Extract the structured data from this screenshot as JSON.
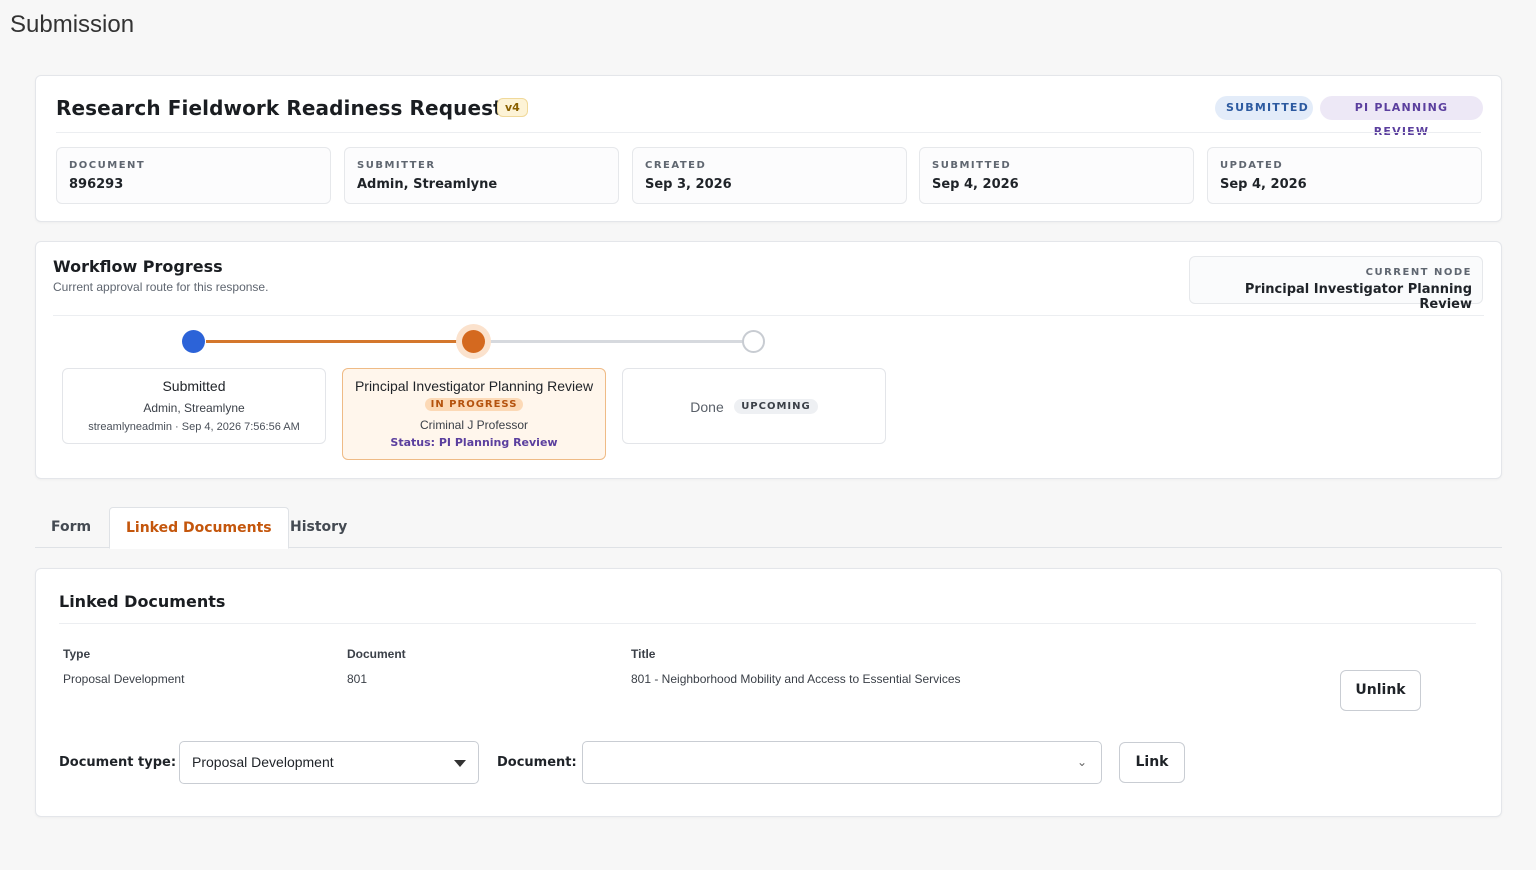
{
  "page": {
    "title": "Submission"
  },
  "header": {
    "title": "Research Fieldwork Readiness Request",
    "version": "v4",
    "status_pills": [
      "SUBMITTED",
      "PI PLANNING REVIEW"
    ],
    "meta": [
      {
        "label": "DOCUMENT",
        "value": "896293"
      },
      {
        "label": "SUBMITTER",
        "value": "Admin, Streamlyne"
      },
      {
        "label": "CREATED",
        "value": "Sep 3, 2026"
      },
      {
        "label": "SUBMITTED",
        "value": "Sep 4, 2026"
      },
      {
        "label": "UPDATED",
        "value": "Sep 4, 2026"
      }
    ]
  },
  "workflow": {
    "title": "Workflow Progress",
    "subtitle": "Current approval route for this response.",
    "current_node_label": "CURRENT NODE",
    "current_node_value": "Principal Investigator Planning Review",
    "steps": [
      {
        "name": "Submitted",
        "actor": "Admin, Streamlyne",
        "meta": "streamlyneadmin · Sep 4, 2026 7:56:56 AM"
      },
      {
        "name": "Principal Investigator Planning Review",
        "badge": "IN PROGRESS",
        "actor": "Criminal J Professor",
        "status": "Status: PI Planning Review"
      },
      {
        "name": "Done",
        "badge": "UPCOMING"
      }
    ]
  },
  "tabs": [
    "Form",
    "Linked Documents",
    "History"
  ],
  "linked": {
    "title": "Linked Documents",
    "columns": [
      "Type",
      "Document",
      "Title"
    ],
    "rows": [
      {
        "type": "Proposal Development",
        "document": "801",
        "title": "801 - Neighborhood Mobility and Access to Essential Services",
        "action": "Unlink"
      }
    ],
    "doc_type_label": "Document type:",
    "doc_type_value": "Proposal Development",
    "document_label": "Document:",
    "document_value": "",
    "link_label": "Link"
  },
  "icons": {
    "select_caret": "caret-down-icon",
    "select_chevron": "chevron-down-icon"
  },
  "colors": {
    "accent": "#c4560c",
    "blue": "#2c63d8",
    "purple": "#5b3f9e"
  }
}
